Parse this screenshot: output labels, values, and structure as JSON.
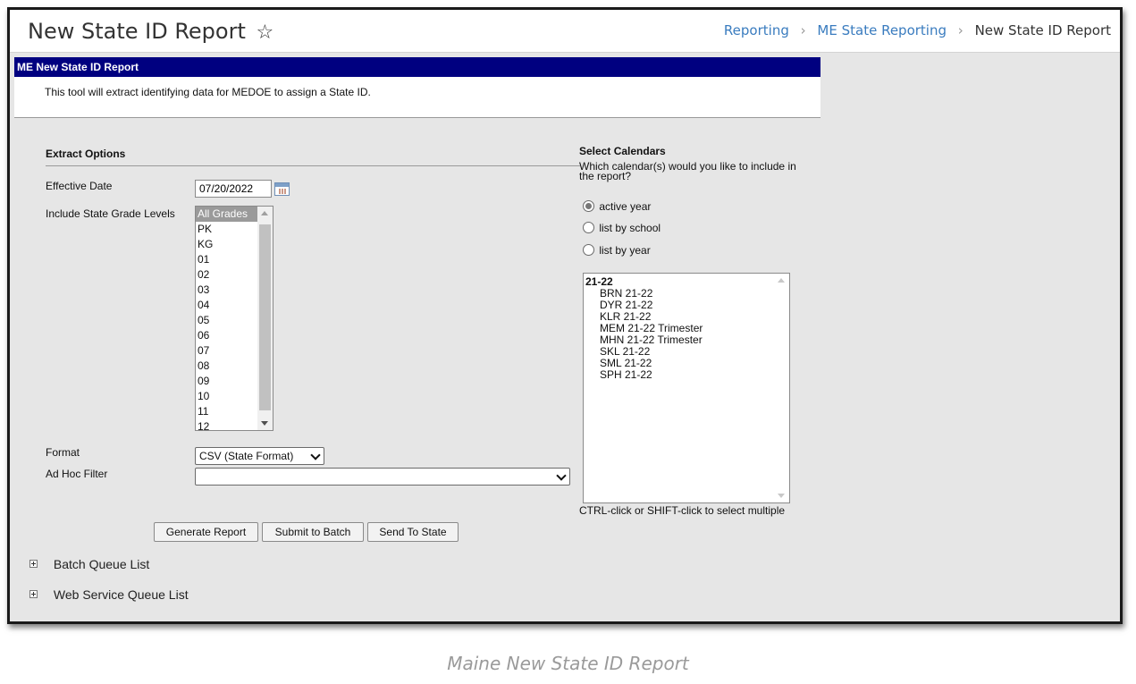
{
  "header": {
    "title": "New State ID Report",
    "breadcrumb": [
      {
        "label": "Reporting"
      },
      {
        "label": "ME State Reporting"
      },
      {
        "label": "New State ID Report"
      }
    ]
  },
  "report": {
    "banner": "ME New State ID Report",
    "description": "This tool will extract identifying data for MEDOE to assign a State ID."
  },
  "extract_options": {
    "heading": "Extract Options",
    "effective_date_label": "Effective Date",
    "effective_date_value": "07/20/2022",
    "grade_levels_label": "Include State Grade Levels",
    "grade_levels": [
      "All Grades",
      "PK",
      "KG",
      "01",
      "02",
      "03",
      "04",
      "05",
      "06",
      "07",
      "08",
      "09",
      "10",
      "11",
      "12"
    ],
    "selected_grade": "All Grades",
    "format_label": "Format",
    "format_value": "CSV (State Format)",
    "ad_hoc_label": "Ad Hoc Filter",
    "ad_hoc_value": ""
  },
  "calendars": {
    "heading": "Select Calendars",
    "question": "Which calendar(s) would you like to include in the report?",
    "radio_options": [
      {
        "label": "active year",
        "checked": true
      },
      {
        "label": "list by school",
        "checked": false
      },
      {
        "label": "list by year",
        "checked": false
      }
    ],
    "group": "21-22",
    "items": [
      "BRN 21-22",
      "DYR 21-22",
      "KLR 21-22",
      "MEM 21-22 Trimester",
      "MHN 21-22 Trimester",
      "SKL 21-22",
      "SML 21-22",
      "SPH 21-22"
    ],
    "hint": "CTRL-click or SHIFT-click to select multiple"
  },
  "buttons": {
    "generate": "Generate Report",
    "submit_batch": "Submit to Batch",
    "send_state": "Send To State"
  },
  "queues": {
    "batch": "Batch Queue List",
    "web_service": "Web Service Queue List"
  },
  "caption": "Maine New State ID Report",
  "colors": {
    "banner_bg": "#000080",
    "link": "#3a7cbf",
    "panel_bg": "#e6e6e6"
  }
}
